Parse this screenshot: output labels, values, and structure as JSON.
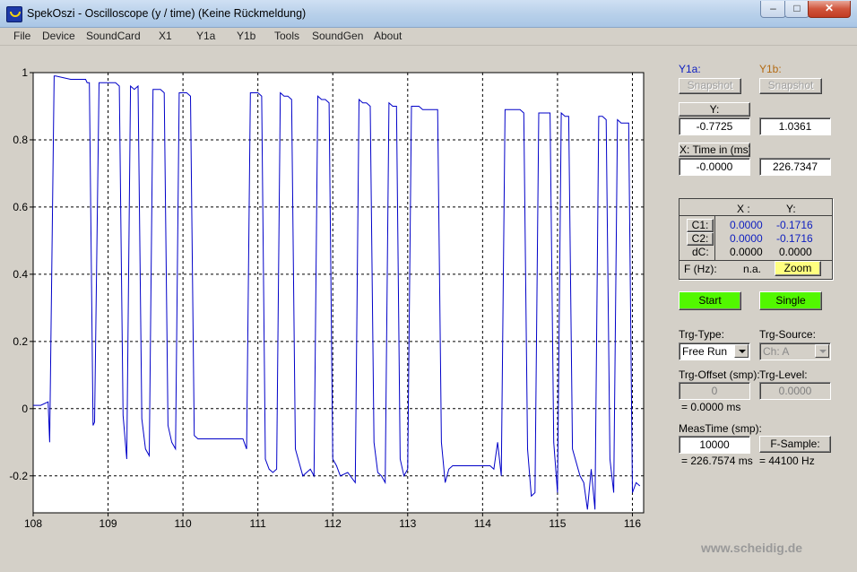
{
  "window": {
    "title": "SpekOszi - Oscilloscope (y / time) (Keine Rückmeldung)",
    "minimize": "–",
    "maximize": "□",
    "close": "✕",
    "icon": "oscilloscope-app-icon"
  },
  "menu": [
    "File",
    "Device",
    "SoundCard",
    "X1",
    "Y1a",
    "Y1b",
    "Tools",
    "SoundGen",
    "About"
  ],
  "chart_data": {
    "type": "line",
    "x_ticks": [
      "108",
      "109",
      "110",
      "111",
      "112",
      "113",
      "114",
      "115",
      "116"
    ],
    "y_ticks": [
      "1",
      "0.8",
      "0.6",
      "0.4",
      "0.2",
      "0",
      "-0.2"
    ],
    "xlim": [
      108,
      116.15
    ],
    "ylim": [
      -0.31,
      1.0
    ],
    "grid": true,
    "series": [
      {
        "color": "#0000c8",
        "x": [
          108,
          108.1,
          108.2,
          108.22,
          108.28,
          108.3,
          108.5,
          108.7,
          108.72,
          108.75,
          108.8,
          108.82,
          108.88,
          108.9,
          109.1,
          109.15,
          109.2,
          109.25,
          109.3,
          109.35,
          109.4,
          109.45,
          109.5,
          109.55,
          109.6,
          109.65,
          109.7,
          109.75,
          109.8,
          109.85,
          109.9,
          109.95,
          110.0,
          110.05,
          110.1,
          110.15,
          110.2,
          110.5,
          110.8,
          110.85,
          110.9,
          111.0,
          111.05,
          111.1,
          111.15,
          111.2,
          111.25,
          111.3,
          111.35,
          111.4,
          111.45,
          111.5,
          111.6,
          111.7,
          111.75,
          111.8,
          111.85,
          111.9,
          111.95,
          112.0,
          112.05,
          112.1,
          112.2,
          112.3,
          112.35,
          112.4,
          112.45,
          112.5,
          112.55,
          112.6,
          112.65,
          112.7,
          112.75,
          112.8,
          112.85,
          112.9,
          112.95,
          113.0,
          113.05,
          113.1,
          113.15,
          113.2,
          113.3,
          113.4,
          113.45,
          113.5,
          113.55,
          113.6,
          113.7,
          113.8,
          113.9,
          114.0,
          114.1,
          114.15,
          114.2,
          114.25,
          114.3,
          114.4,
          114.5,
          114.55,
          114.6,
          114.65,
          114.7,
          114.75,
          114.8,
          114.9,
          114.95,
          115.0,
          115.05,
          115.1,
          115.15,
          115.2,
          115.3,
          115.35,
          115.4,
          115.45,
          115.5,
          115.55,
          115.6,
          115.65,
          115.7,
          115.75,
          115.8,
          115.85,
          115.9,
          115.95,
          116.0,
          116.05,
          116.1
        ],
        "y": [
          0.01,
          0.01,
          0.02,
          -0.1,
          0.99,
          0.99,
          0.98,
          0.98,
          0.97,
          0.97,
          -0.05,
          -0.04,
          0.97,
          0.97,
          0.97,
          0.96,
          -0.02,
          -0.15,
          0.96,
          0.95,
          0.96,
          -0.03,
          -0.12,
          -0.14,
          0.95,
          0.95,
          0.95,
          0.94,
          -0.05,
          -0.1,
          -0.12,
          0.94,
          0.94,
          0.94,
          0.93,
          -0.08,
          -0.09,
          -0.09,
          -0.09,
          -0.12,
          0.94,
          0.94,
          0.93,
          -0.15,
          -0.18,
          -0.19,
          -0.18,
          0.94,
          0.93,
          0.93,
          0.92,
          -0.12,
          -0.2,
          -0.18,
          -0.2,
          0.93,
          0.92,
          0.92,
          0.91,
          -0.15,
          -0.17,
          -0.2,
          -0.19,
          -0.22,
          0.92,
          0.91,
          0.91,
          0.9,
          -0.1,
          -0.19,
          -0.2,
          -0.22,
          0.91,
          0.9,
          0.9,
          -0.15,
          -0.2,
          -0.18,
          0.9,
          0.9,
          0.9,
          0.89,
          0.89,
          0.89,
          -0.1,
          -0.22,
          -0.18,
          -0.17,
          -0.17,
          -0.17,
          -0.17,
          -0.17,
          -0.17,
          -0.18,
          -0.1,
          -0.2,
          0.89,
          0.89,
          0.89,
          0.88,
          -0.12,
          -0.26,
          -0.25,
          0.88,
          0.88,
          0.88,
          -0.1,
          -0.25,
          0.88,
          0.87,
          0.87,
          -0.12,
          -0.2,
          -0.22,
          -0.3,
          -0.18,
          -0.3,
          0.87,
          0.87,
          0.86,
          -0.15,
          -0.25,
          0.86,
          0.85,
          0.85,
          0.85,
          -0.25,
          -0.22,
          -0.23
        ]
      }
    ]
  },
  "panel": {
    "y1a_label": "Y1a:",
    "y1b_label": "Y1b:",
    "snapshot_label": "Snapshot",
    "y_button": "Y:",
    "y1a_value": "-0.7725",
    "y1b_value": "1.0361",
    "x_button": "X: Time in (ms)",
    "x1a_value": "-0.0000",
    "x1b_value": "226.7347",
    "cursor_table": {
      "x_header": "X :",
      "y_header": "Y:",
      "c1_label": "C1:",
      "c1_x": "0.0000",
      "c1_y": "-0.1716",
      "c2_label": "C2:",
      "c2_x": "0.0000",
      "c2_y": "-0.1716",
      "dc_label": "dC:",
      "dc_x": "0.0000",
      "dc_y": "0.0000",
      "f_label": "F (Hz):",
      "f_value": "n.a.",
      "zoom_label": "Zoom"
    },
    "start_label": "Start",
    "single_label": "Single",
    "trg_type_label": "Trg-Type:",
    "trg_type_value": "Free Run",
    "trg_source_label": "Trg-Source:",
    "trg_source_value": "Ch: A",
    "trg_offset_label": "Trg-Offset (smp):",
    "trg_offset_value": "0",
    "trg_offset_ms": "= 0.0000 ms",
    "trg_level_label": "Trg-Level:",
    "trg_level_value": "0.0000",
    "meas_time_label": "MeasTime (smp):",
    "meas_time_value": "10000",
    "meas_time_ms": "= 226.7574 ms",
    "fsample_button": "F-Sample:",
    "fsample_value": "= 44100 Hz"
  },
  "watermark": "www.scheidig.de"
}
